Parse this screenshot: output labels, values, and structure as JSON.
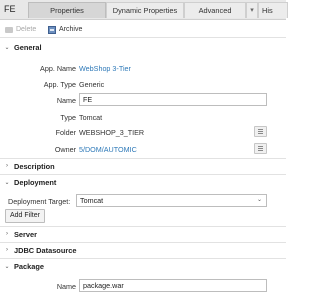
{
  "header": {
    "object_name": "FE",
    "tabs": [
      {
        "label": "Properties",
        "active": true
      },
      {
        "label": "Dynamic Properties"
      },
      {
        "label": "Advanced"
      },
      {
        "label": "His"
      }
    ],
    "overflow_icon": "chevron-down-icon"
  },
  "toolbar": {
    "delete_label": "Delete",
    "archive_label": "Archive"
  },
  "sections": {
    "general": "General",
    "description": "Description",
    "deployment": "Deployment",
    "server": "Server",
    "jdbc": "JDBC Datasource",
    "package": "Package"
  },
  "general": {
    "app_name_label": "App. Name",
    "app_name_value": "WebShop 3-Tier",
    "app_type_label": "App. Type",
    "app_type_value": "Generic",
    "name_label": "Name",
    "name_value": "FE",
    "type_label": "Type",
    "type_value": "Tomcat",
    "folder_label": "Folder",
    "folder_value": "WEBSHOP_3_TIER",
    "owner_label": "Owner",
    "owner_value": "5/DOM/AUTOMIC"
  },
  "deployment": {
    "target_label": "Deployment Target:",
    "target_value": "Tomcat",
    "add_filter_label": "Add Filter"
  },
  "package": {
    "name_label": "Name",
    "name_value": "package.war"
  },
  "colors": {
    "link": "#2e79b8",
    "tab_active": "#d6d6d6"
  }
}
